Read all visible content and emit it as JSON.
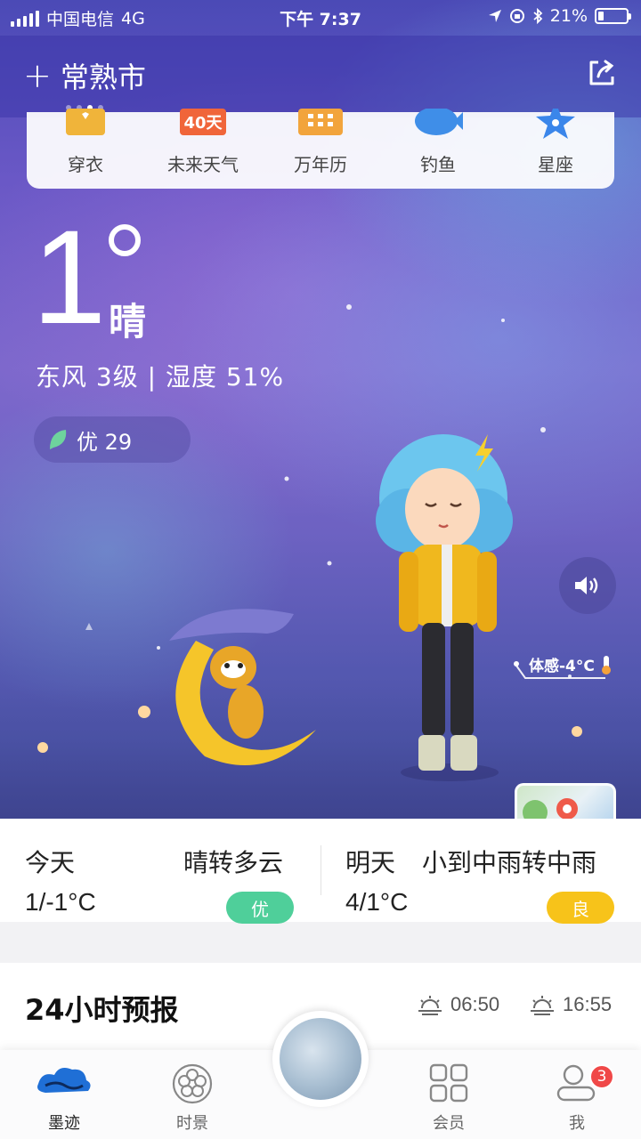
{
  "status_bar": {
    "carrier": "中国电信",
    "network": "4G",
    "time": "下午 7:37",
    "battery": "21%",
    "battery_level": 0.21
  },
  "header": {
    "city": "常熟市",
    "page_count": 4,
    "active_page": 3
  },
  "tools": [
    {
      "label": "穿衣",
      "icon": "clothes-icon"
    },
    {
      "label": "未来天气",
      "icon": "forecast-40-icon",
      "badge": "40天"
    },
    {
      "label": "万年历",
      "icon": "calendar-icon"
    },
    {
      "label": "钓鱼",
      "icon": "fish-icon"
    },
    {
      "label": "星座",
      "icon": "star-icon"
    }
  ],
  "current": {
    "temperature": "1",
    "condition": "晴",
    "wind_humidity": "东风 3级 | 湿度 51%",
    "aqi_label": "优 29",
    "feels_like": "体感-4°C"
  },
  "forecast": {
    "today": {
      "day": "今天",
      "weather": "晴转多云",
      "range": "1/-1°C",
      "aqi": "优",
      "aqi_color": "#4fcf9a"
    },
    "tomorrow": {
      "day": "明天",
      "weather": "小到中雨转中雨",
      "range": "4/1°C",
      "aqi": "良",
      "aqi_color": "#f7c31a"
    }
  },
  "hourly": {
    "title": "24小时预报",
    "sunrise": "06:50",
    "sunset": "16:55"
  },
  "tabbar": {
    "tabs": [
      {
        "label": "墨迹",
        "icon": "moji-cloud-icon"
      },
      {
        "label": "时景",
        "icon": "flower-icon"
      },
      {
        "label": "会员",
        "icon": "grid-icon"
      },
      {
        "label": "我",
        "icon": "profile-icon"
      }
    ],
    "me_badge": "3"
  },
  "colors": {
    "sky_top": "#4b4ab6",
    "sky_mid": "#7d68cc",
    "aqi_good": "#4fcf9a",
    "aqi_moderate": "#f7c31a",
    "badge_red": "#f04848"
  }
}
